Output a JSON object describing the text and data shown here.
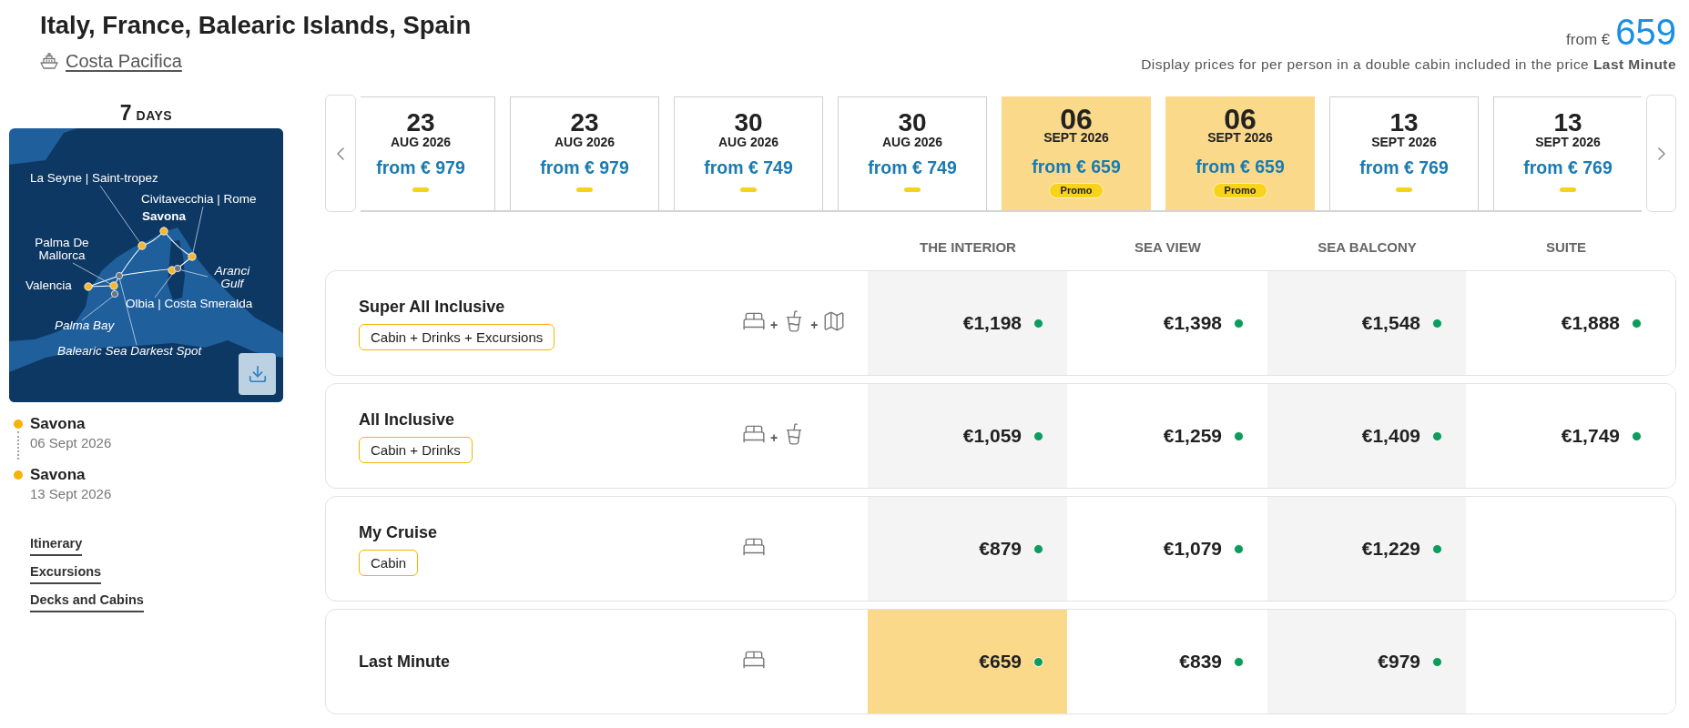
{
  "header": {
    "title": "Italy, France, Balearic Islands, Spain",
    "ship": "Costa Pacifica"
  },
  "price_summary": {
    "prefix": "from €",
    "amount": "659",
    "note": "Display prices for per person in a double cabin included in the price **Last Minute**"
  },
  "itinerary": {
    "duration": {
      "number": "7",
      "unit": "DAYS"
    },
    "map": {
      "labels": [
        {
          "text": "La Seyne | Saint-tropez",
          "kind": "port"
        },
        {
          "text": "Civitavecchia | Rome",
          "kind": "port"
        },
        {
          "text": "Savona",
          "kind": "home"
        },
        {
          "text": "Palma De Mallorca",
          "kind": "port"
        },
        {
          "text": "Aranci Gulf",
          "kind": "scenic"
        },
        {
          "text": "Valencia",
          "kind": "port"
        },
        {
          "text": "Olbia | Costa Smeralda",
          "kind": "port"
        },
        {
          "text": "Palma Bay",
          "kind": "scenic"
        },
        {
          "text": "Balearic Sea Darkest Spot",
          "kind": "scenic"
        }
      ]
    },
    "stops": [
      {
        "port": "Savona",
        "date": "06 Sept 2026"
      },
      {
        "port": "Savona",
        "date": "13 Sept 2026"
      }
    ],
    "links": [
      "Itinerary",
      "Excursions",
      "Decks and Cabins"
    ]
  },
  "departures": [
    {
      "day": "23",
      "month": "AUG 2026",
      "price": "from € 979",
      "selected": false
    },
    {
      "day": "23",
      "month": "AUG 2026",
      "price": "from € 979",
      "selected": false
    },
    {
      "day": "30",
      "month": "AUG 2026",
      "price": "from € 749",
      "selected": false
    },
    {
      "day": "30",
      "month": "AUG 2026",
      "price": "from € 749",
      "selected": false
    },
    {
      "day": "06",
      "month": "SEPT 2026",
      "price": "from € 659",
      "selected": true,
      "badge": "Promo"
    },
    {
      "day": "06",
      "month": "SEPT 2026",
      "price": "from € 659",
      "selected": true,
      "badge": "Promo"
    },
    {
      "day": "13",
      "month": "SEPT 2026",
      "price": "from € 769",
      "selected": false
    },
    {
      "day": "13",
      "month": "SEPT 2026",
      "price": "from € 769",
      "selected": false
    }
  ],
  "fares": {
    "columns": [
      "THE INTERIOR",
      "SEA VIEW",
      "SEA BALCONY",
      "SUITE"
    ],
    "rows": [
      {
        "name": "Super All Inclusive",
        "tag": "Cabin + Drinks + Excursions",
        "amenities": [
          {
            "kind": "bed"
          },
          {
            "kind": "drink",
            "joiner": "+"
          },
          {
            "kind": "map",
            "joiner": "+"
          }
        ],
        "prices": [
          {
            "text": "€1,198",
            "selected": false,
            "available": true
          },
          {
            "text": "€1,398",
            "selected": false,
            "available": true
          },
          {
            "text": "€1,548",
            "selected": false,
            "available": true
          },
          {
            "text": "€1,888",
            "selected": false,
            "available": true
          }
        ]
      },
      {
        "name": "All Inclusive",
        "tag": "Cabin + Drinks",
        "amenities": [
          {
            "kind": "bed"
          },
          {
            "kind": "drink",
            "joiner": "+"
          }
        ],
        "prices": [
          {
            "text": "€1,059",
            "selected": false,
            "available": true
          },
          {
            "text": "€1,259",
            "selected": false,
            "available": true
          },
          {
            "text": "€1,409",
            "selected": false,
            "available": true
          },
          {
            "text": "€1,749",
            "selected": false,
            "available": true
          }
        ]
      },
      {
        "name": "My Cruise",
        "tag": "Cabin",
        "amenities": [
          {
            "kind": "bed"
          }
        ],
        "prices": [
          {
            "text": "€879",
            "selected": false,
            "available": true
          },
          {
            "text": "€1,079",
            "selected": false,
            "available": true
          },
          {
            "text": "€1,229",
            "selected": false,
            "available": true
          }
        ]
      },
      {
        "name": "Last Minute",
        "amenities": [
          {
            "kind": "bed"
          }
        ],
        "prices": [
          {
            "text": "€659",
            "selected": true,
            "available": true
          },
          {
            "text": "€839",
            "selected": false,
            "available": true
          },
          {
            "text": "€979",
            "selected": false,
            "available": true
          }
        ]
      }
    ]
  }
}
